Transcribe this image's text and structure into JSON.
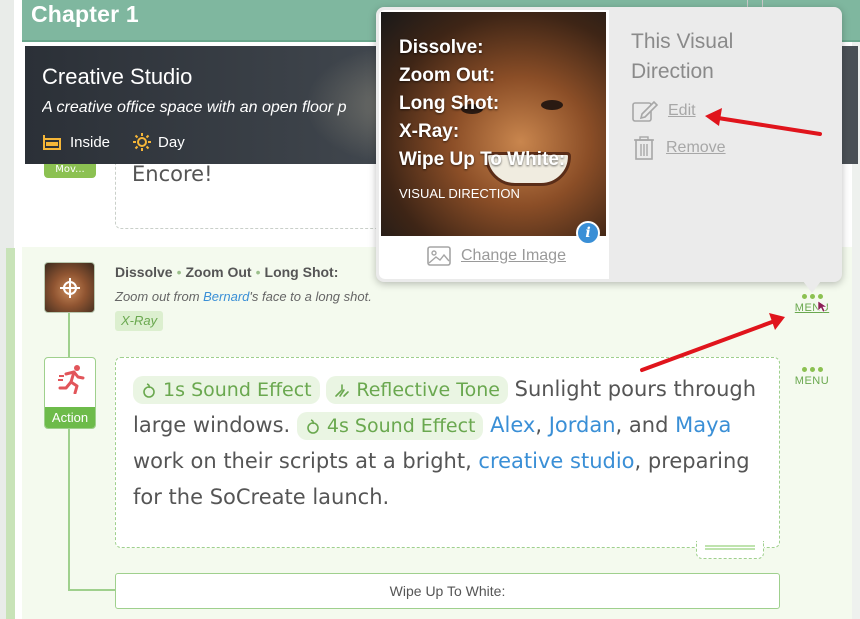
{
  "chapter": {
    "title": "Chapter 1"
  },
  "scene": {
    "name": "Creative Studio",
    "description": "A creative office space with an open floor p",
    "location": "Inside",
    "time": "Day"
  },
  "upper_block": {
    "tag": "Mov...",
    "text": "Encore!"
  },
  "visual_direction_item": {
    "line_parts": [
      "Dissolve",
      "Zoom Out",
      "Long Shot:"
    ],
    "description_before": "Zoom out from ",
    "description_link": "Bernard",
    "description_after": "'s face to a long shot.",
    "tag": "X-Ray"
  },
  "menu": {
    "label": "MENU"
  },
  "action": {
    "label": "Action",
    "tag1": "1s Sound Effect",
    "tag2": "Reflective Tone",
    "text1": " Sunlight pours through large windows. ",
    "tag3": "4s Sound Effect",
    "person1": "Alex",
    "person2": "Jordan",
    "person3": "Maya",
    "text2": " work on their scripts at a bright, ",
    "location_link": "creative studio",
    "text3": ", preparing for the SoCreate launch."
  },
  "transition": {
    "text": "Wipe Up To White:"
  },
  "popup": {
    "image_lines": [
      "Dissolve:",
      "Zoom Out:",
      "Long Shot:",
      "X-Ray:",
      "Wipe Up To White:"
    ],
    "image_caption": "VISUAL DIRECTION",
    "change_image": "Change Image",
    "title": "This Visual Direction",
    "edit": "Edit",
    "remove": "Remove"
  },
  "colors": {
    "accent_green": "#8cc152",
    "link_blue": "#3a8fd6",
    "arrow_red": "#e0141c",
    "chapter_bar": "#7fb79f"
  }
}
